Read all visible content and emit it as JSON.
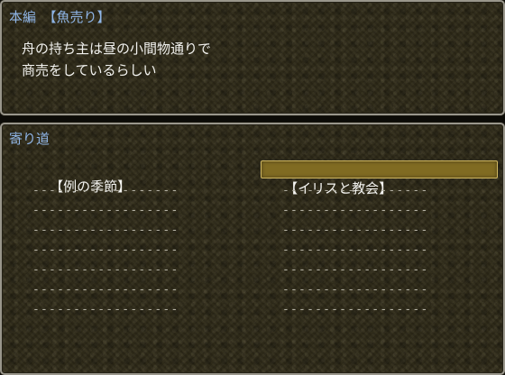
{
  "story_window": {
    "heading": "本編　【魚売り】",
    "lines": [
      "舟の持ち主は昼の小間物通りで",
      "商売をしているらしい"
    ]
  },
  "detour_window": {
    "heading": "寄り道",
    "left_items": [
      "【例の季節】",
      "------------------",
      "------------------",
      "------------------",
      "------------------",
      "------------------",
      "------------------",
      "------------------"
    ],
    "right_items": [
      "【イリスと教会】",
      "------------------",
      "------------------",
      "------------------",
      "------------------",
      "------------------",
      "------------------",
      "------------------"
    ],
    "selected_column": "right",
    "selected_index": 0
  },
  "colors": {
    "heading": "#8fb5e6",
    "text": "#f2f2ef",
    "cursor_fill": "#806b22",
    "cursor_border": "#d2b962"
  }
}
